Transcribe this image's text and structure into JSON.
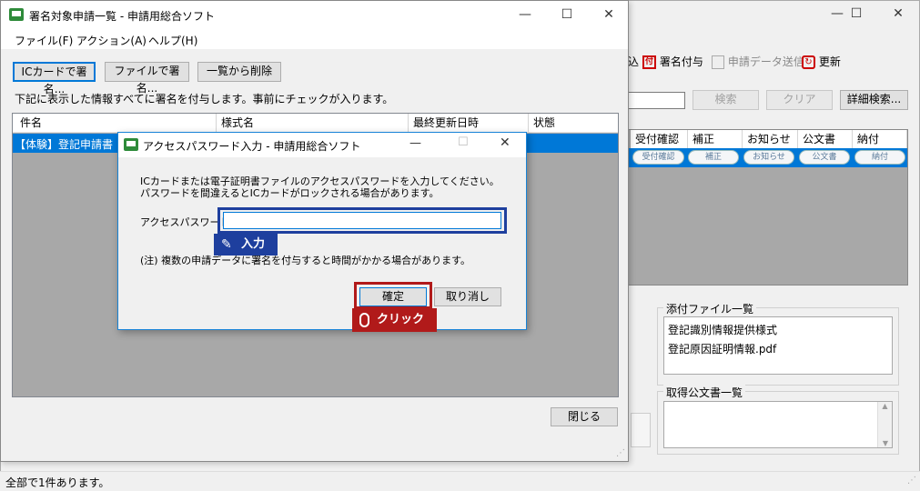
{
  "bg_window": {
    "toolbar": {
      "partial_item": "込",
      "sign_label": "署名付与",
      "send_label": "申請データ送信",
      "refresh_label": "更新"
    },
    "search_button": "検索",
    "clear_button": "クリア",
    "detail_search_button": "詳細検索...",
    "columns": [
      "受付確認",
      "補正",
      "お知らせ",
      "公文書",
      "納付"
    ],
    "pills": [
      "受付確認",
      "補正",
      "お知らせ",
      "公文書",
      "納付"
    ],
    "attachments_title": "添付ファイル一覧",
    "attachments": [
      "登記識別情報提供様式",
      "登記原因証明情報.pdf"
    ],
    "official_docs_title": "取得公文書一覧",
    "status_text": "全部で1件あります。"
  },
  "main_window": {
    "title": "署名対象申請一覧 - 申請用総合ソフト",
    "menu": [
      "ファイル(F)",
      "アクション(A)",
      "ヘルプ(H)"
    ],
    "buttons": {
      "ic_sign": "ICカードで署名...",
      "file_sign": "ファイルで署名...",
      "remove": "一覧から削除"
    },
    "instruction": "下記に表示した情報すべてに署名を付与します。事前にチェックが入ります。",
    "table": {
      "headers": [
        "件名",
        "様式名",
        "最終更新日時",
        "状態"
      ],
      "rows": [
        [
          "【体験】登記申請書",
          "",
          "",
          ""
        ]
      ]
    },
    "close_button": "閉じる"
  },
  "dialog": {
    "title": "アクセスパスワード入力 - 申請用総合ソフト",
    "message_line1": "ICカードまたは電子証明書ファイルのアクセスパスワードを入力してください。",
    "message_line2": "パスワードを間違えるとICカードがロックされる場合があります。",
    "password_label": "アクセスパスワード",
    "password_value": "",
    "note": "(注) 複数の申請データに署名を付与すると時間がかかる場合があります。",
    "ok_button": "確定",
    "cancel_button": "取り消し"
  },
  "callouts": {
    "input_label": "入力",
    "click_label": "クリック"
  },
  "colors": {
    "highlight_blue": "#1e3f9e",
    "callout_red": "#b11a1a",
    "selection_blue": "#0078d7"
  }
}
